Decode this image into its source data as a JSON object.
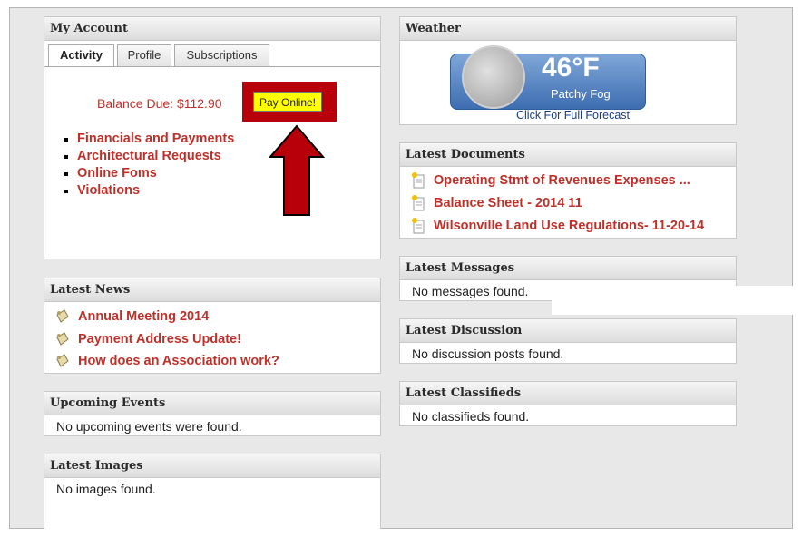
{
  "my_account": {
    "title": "My Account",
    "tabs": [
      "Activity",
      "Profile",
      "Subscriptions"
    ],
    "balance_label": "Balance Due:",
    "balance_value": "$112.90",
    "pay_button": "Pay Online!",
    "links": [
      "Financials and Payments",
      "Architectural Requests",
      "Online Foms",
      "Violations"
    ]
  },
  "latest_news": {
    "title": "Latest News",
    "items": [
      "Annual Meeting 2014",
      "Payment Address Update!",
      "How does an Association work?"
    ]
  },
  "upcoming_events": {
    "title": "Upcoming Events",
    "message": "No upcoming events were found."
  },
  "latest_images": {
    "title": "Latest Images",
    "message": "No images found."
  },
  "weather": {
    "title": "Weather",
    "temperature": "46°F",
    "condition": "Patchy Fog",
    "forecast_link": "Click For Full Forecast"
  },
  "latest_documents": {
    "title": "Latest Documents",
    "items": [
      "Operating Stmt of Revenues Expenses ...",
      "Balance Sheet - 2014 11",
      "Wilsonville Land Use Regulations- 11-20-14"
    ]
  },
  "latest_messages": {
    "title": "Latest Messages",
    "message": "No messages found."
  },
  "latest_discussion": {
    "title": "Latest Discussion",
    "message": "No discussion posts found."
  },
  "latest_classifieds": {
    "title": "Latest Classifieds",
    "message": "No classifieds found."
  },
  "colors": {
    "link": "#c0302a",
    "annotation": "#b8000a",
    "pay_button_bg": "#ffff00",
    "weather_blue": "#4a7dbd"
  }
}
